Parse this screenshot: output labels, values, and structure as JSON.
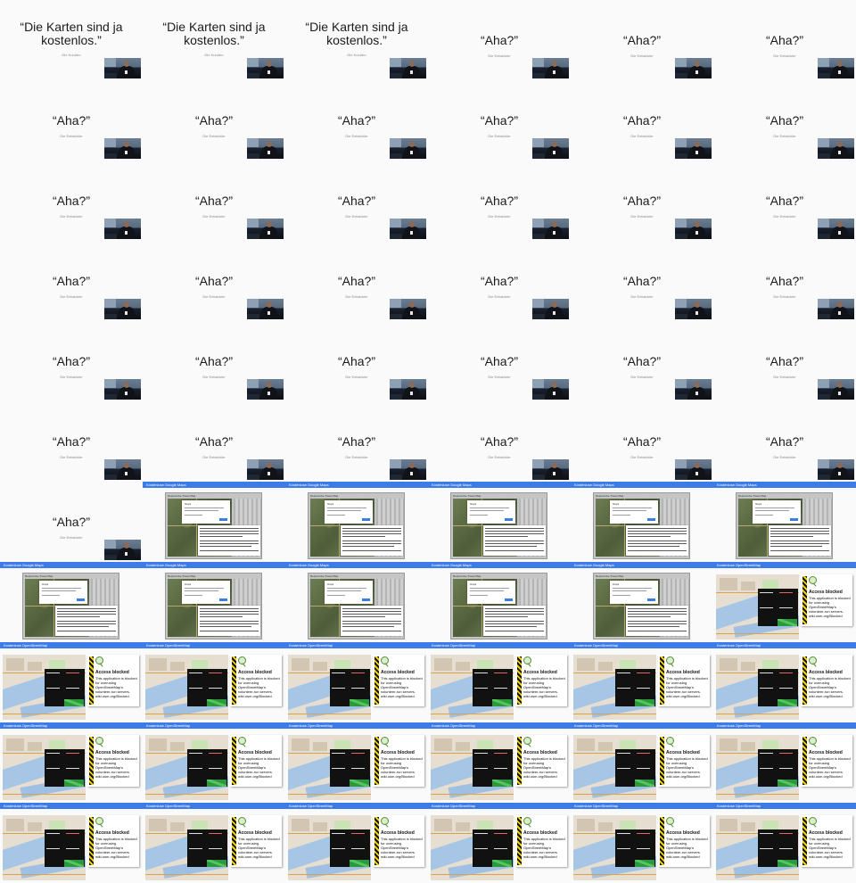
{
  "quote_slides": {
    "long": {
      "quote": "“Die Karten sind ja kostenlos.”",
      "author": "Die Kunden"
    },
    "short": {
      "quote": "“Aha?”",
      "author": "Die Entwickler"
    }
  },
  "google_slide": {
    "header": "Kostenlose Google Maps",
    "inner_title": "Responsive Travel Map",
    "dialog_title": "Oops"
  },
  "osm_slide": {
    "header": "Kostenlose OpenStreetMap",
    "title": "Access blocked",
    "message": "This application is blocked for overusing OpenStreetMap's volunteer-run servers. wiki.osm.org/Blocked"
  },
  "layout_rows": [
    [
      "quote_long",
      "quote_long",
      "quote_long",
      "quote_short",
      "quote_short",
      "quote_short"
    ],
    [
      "quote_short",
      "quote_short",
      "quote_short",
      "quote_short",
      "quote_short",
      "quote_short"
    ],
    [
      "quote_short",
      "quote_short",
      "quote_short",
      "quote_short",
      "quote_short",
      "quote_short"
    ],
    [
      "quote_short",
      "quote_short",
      "quote_short",
      "quote_short",
      "quote_short",
      "quote_short"
    ],
    [
      "quote_short",
      "quote_short",
      "quote_short",
      "quote_short",
      "quote_short",
      "quote_short"
    ],
    [
      "quote_short",
      "quote_short",
      "quote_short",
      "quote_short",
      "quote_short",
      "quote_short"
    ],
    [
      "quote_short",
      "google",
      "google",
      "google",
      "google",
      "google"
    ],
    [
      "google",
      "google",
      "google",
      "google",
      "google",
      "osm"
    ],
    [
      "osm",
      "osm",
      "osm",
      "osm",
      "osm",
      "osm"
    ],
    [
      "osm",
      "osm",
      "osm",
      "osm",
      "osm",
      "osm"
    ],
    [
      "osm",
      "osm",
      "osm",
      "osm",
      "osm",
      "osm"
    ]
  ],
  "colors": {
    "header_bar": "#3d7be8",
    "page_background": "#fafafa"
  }
}
